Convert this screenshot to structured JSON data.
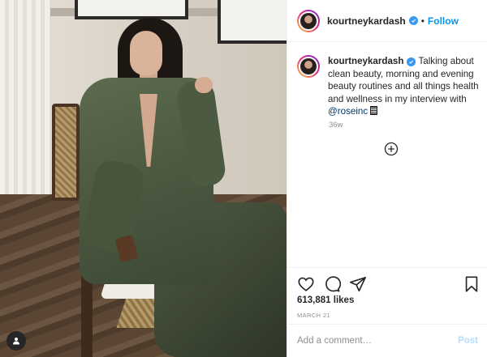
{
  "header": {
    "username": "kourtneykardash",
    "separator": "•",
    "follow_label": "Follow"
  },
  "caption": {
    "username": "kourtneykardash",
    "text": "Talking about clean beauty, morning and evening beauty routines and all things health and wellness in my interview with ",
    "mention": "@roseinc",
    "time_ago": "36w"
  },
  "stats": {
    "likes": "613,881 likes",
    "date": "MARCH 21"
  },
  "comment": {
    "placeholder": "Add a comment…",
    "post_label": "Post"
  },
  "colors": {
    "accent": "#0095f6",
    "verified": "#3897f0",
    "post_disabled": "#b2dffc"
  },
  "icons": [
    "verified-badge-icon",
    "heart-icon",
    "comment-icon",
    "share-icon",
    "bookmark-icon",
    "add-circle-icon",
    "user-tag-icon"
  ]
}
